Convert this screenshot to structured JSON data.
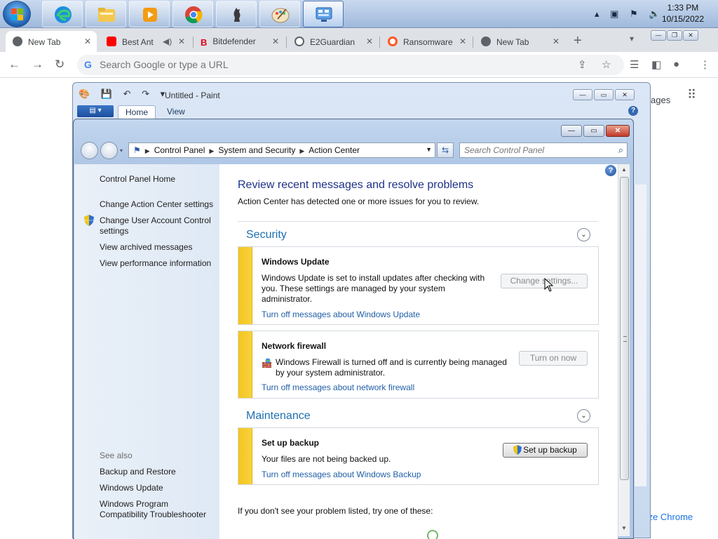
{
  "taskbar": {
    "apps": [
      "windows-explorer",
      "edge",
      "file-manager",
      "media-player",
      "chrome",
      "chess",
      "paint",
      "control-panel"
    ],
    "clock_time": "1:33 PM",
    "clock_date": "10/15/2022"
  },
  "chrome": {
    "tabs": [
      {
        "label": "New Tab",
        "favicon_color": "#5f6368"
      },
      {
        "label": "Best Ant",
        "favicon_color": "#ff0000"
      },
      {
        "label": "Bitdefender",
        "favicon_color": "#e2001a"
      },
      {
        "label": "E2Guardian",
        "favicon_color": "#5f6368"
      },
      {
        "label": "Ransomware",
        "favicon_color": "#ff5722"
      },
      {
        "label": "New Tab",
        "favicon_color": "#5f6368"
      }
    ],
    "omnibox_placeholder": "Search Google or type a URL",
    "page_partial_text": "ages",
    "customize_text": "tomize Chrome"
  },
  "paint": {
    "title": "Untitled - Paint",
    "tabs": [
      "Home",
      "View"
    ]
  },
  "control_panel": {
    "breadcrumbs": [
      "Control Panel",
      "System and Security",
      "Action Center"
    ],
    "search_placeholder": "Search Control Panel",
    "sidebar": {
      "home": "Control Panel Home",
      "links": [
        "Change Action Center settings",
        "Change User Account Control settings",
        "View archived messages",
        "View performance information"
      ],
      "see_also_label": "See also",
      "see_also": [
        "Backup and Restore",
        "Windows Update",
        "Windows Program Compatibility Troubleshooter"
      ]
    },
    "heading": "Review recent messages and resolve problems",
    "subheading": "Action Center has detected one or more issues for you to review.",
    "security": {
      "title": "Security",
      "windows_update": {
        "title": "Windows Update",
        "body": "Windows Update is set to install updates after checking with you.  These settings are managed by your system administrator.",
        "button": "Change settings...",
        "link": "Turn off messages about Windows Update"
      },
      "firewall": {
        "title": "Network firewall",
        "body": "Windows Firewall is turned off and is currently being managed by your system administrator.",
        "button": "Turn on now",
        "link": "Turn off messages about network firewall"
      }
    },
    "maintenance": {
      "title": "Maintenance",
      "backup": {
        "title": "Set up backup",
        "body": "Your files are not being backed up.",
        "button": "Set up backup",
        "link": "Turn off messages about Windows Backup"
      }
    },
    "footer": "If you don't see your problem listed, try one of these:"
  },
  "colors": {
    "link_blue": "#1f5fa8",
    "heading_blue": "#1e3287",
    "section_blue": "#1e6fb0",
    "warning_yellow": "#f3c51f"
  }
}
